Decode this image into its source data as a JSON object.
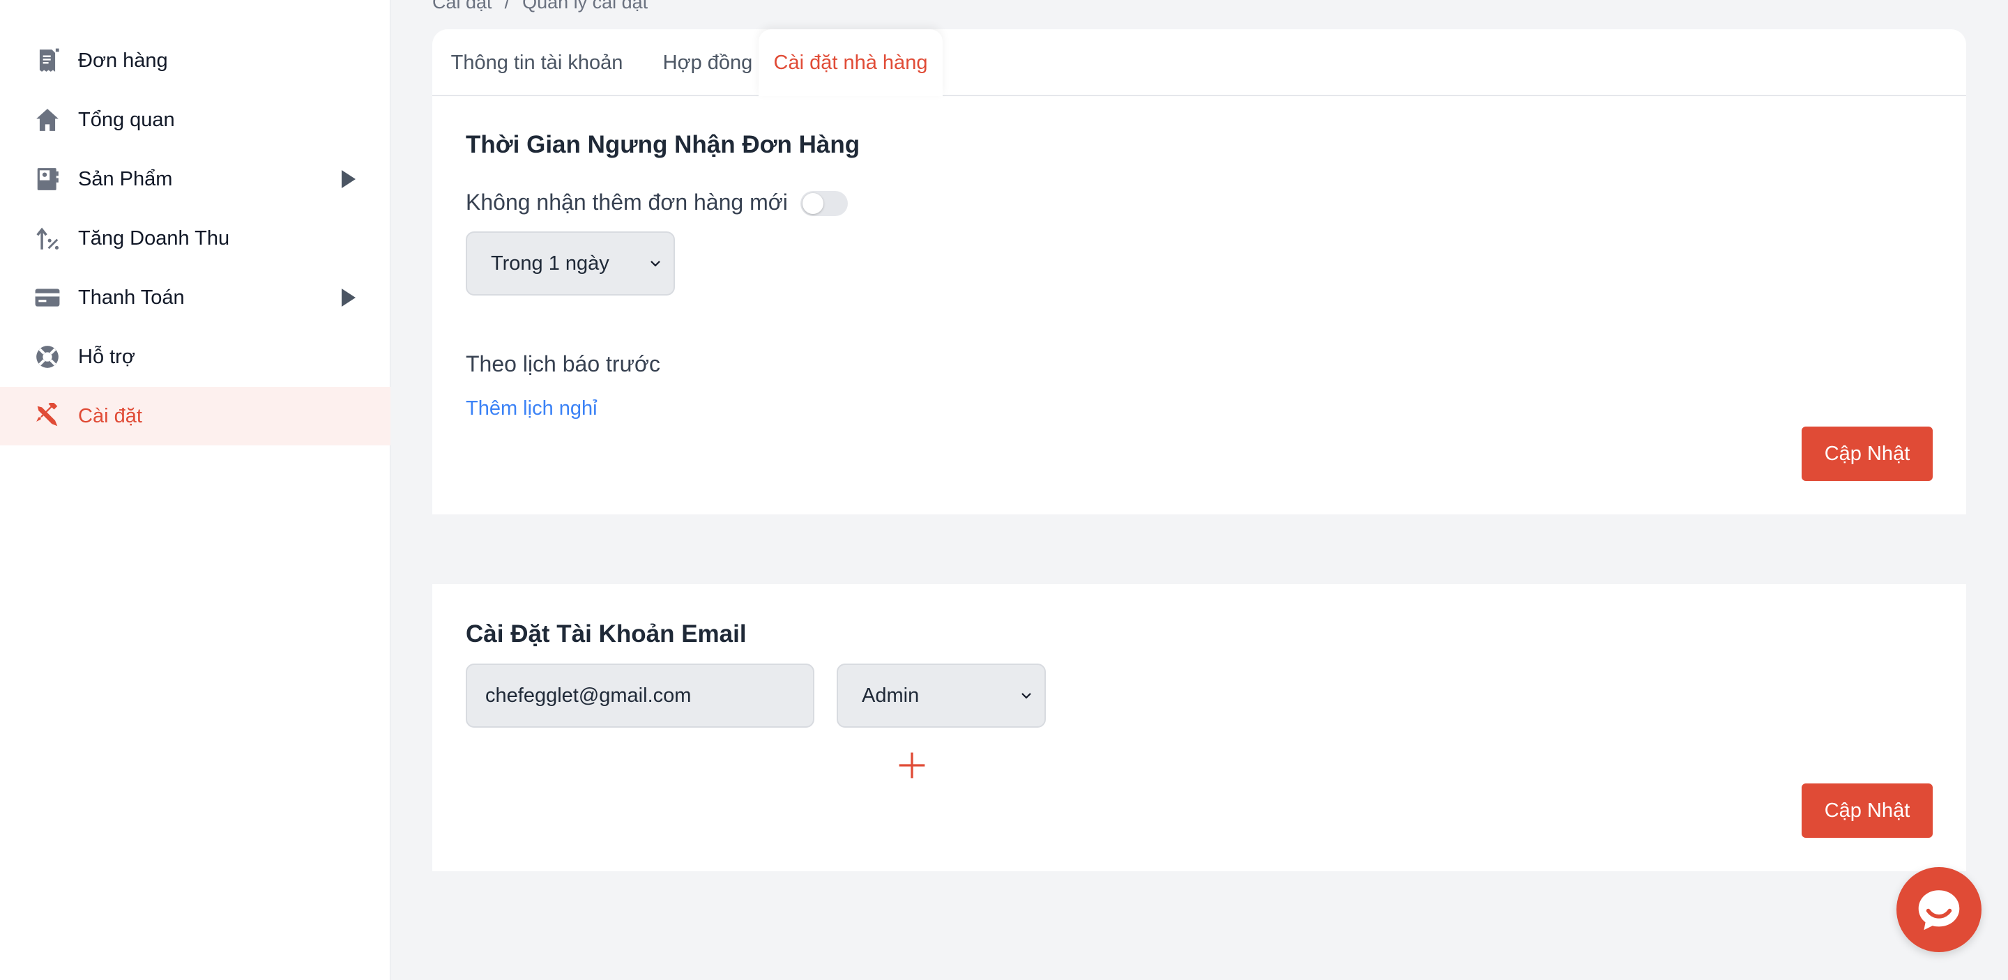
{
  "sidebar": {
    "items": [
      {
        "label": "Đơn hàng",
        "icon": "receipt-icon"
      },
      {
        "label": "Tổng quan",
        "icon": "home-icon"
      },
      {
        "label": "Sản Phẩm",
        "icon": "book-icon"
      },
      {
        "label": "Tăng Doanh Thu",
        "icon": "percent-up-icon"
      },
      {
        "label": "Thanh Toán",
        "icon": "credit-card-icon"
      },
      {
        "label": "Hỗ trợ",
        "icon": "lifebuoy-icon"
      },
      {
        "label": "Cài đặt",
        "icon": "tools-icon"
      }
    ]
  },
  "breadcrumb": {
    "items": [
      "Cài đặt",
      "/",
      "Quản lý cài đặt"
    ]
  },
  "tabs": [
    {
      "label": "Thông tin tài khoản"
    },
    {
      "label": "Hợp đồng"
    },
    {
      "label": "Cài đặt nhà hàng",
      "active": true
    }
  ],
  "pause_section": {
    "title": "Thời Gian Ngưng Nhận Đơn Hàng",
    "toggle_label": "Không nhận thêm đơn hàng mới",
    "toggle_on": false,
    "duration_select": "Trong 1 ngày",
    "schedule_label": "Theo lịch báo trước",
    "add_schedule_link": "Thêm lịch nghỉ",
    "update_button": "Cập Nhật"
  },
  "email_section": {
    "title": "Cài Đặt Tài Khoản Email",
    "email_value": "chefegglet@gmail.com",
    "role_select": "Admin",
    "update_button": "Cập Nhật"
  },
  "colors": {
    "accent": "#e04b36",
    "active_bg": "#fdf0ee",
    "link": "#3b82f6"
  }
}
